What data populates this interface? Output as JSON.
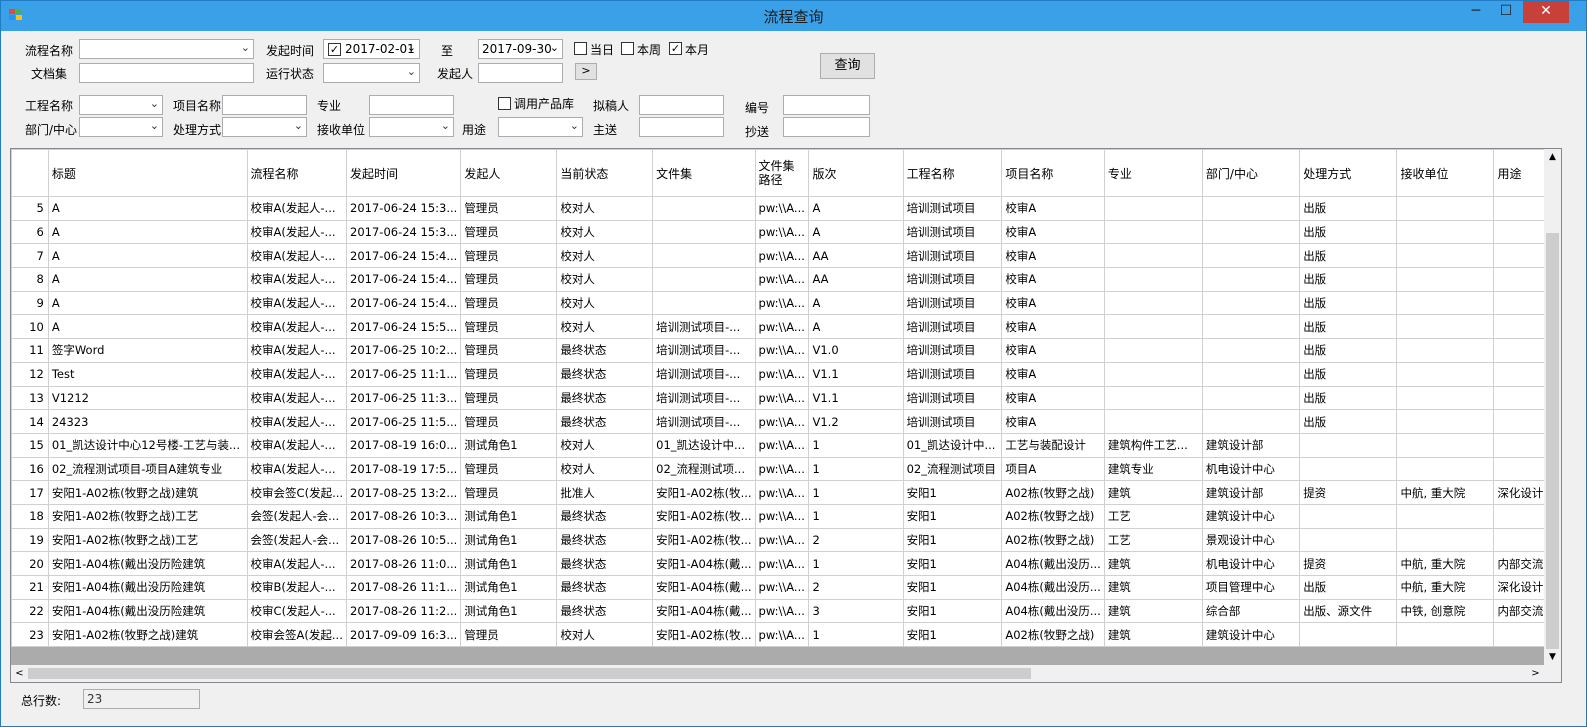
{
  "window": {
    "title": "流程查询",
    "min": "─",
    "max": "☐",
    "close": "✕"
  },
  "filters": {
    "flow_name_label": "流程名称",
    "flow_name_value": "",
    "start_time_label": "发起时间",
    "start_from": "2017-02-01",
    "to_label": "至",
    "start_to": "2017-09-30",
    "today_label": "当日",
    "week_label": "本周",
    "month_label": "本月",
    "docset_label": "文档集",
    "run_status_label": "运行状态",
    "initiator_label": "发起人",
    "more_label": ">",
    "query_label": "查询",
    "project_label": "工程名称",
    "item_label": "项目名称",
    "major_label": "专业",
    "use_product_label": "调用产品库",
    "drafter_label": "拟稿人",
    "number_label": "编号",
    "dept_label": "部门/中心",
    "handle_label": "处理方式",
    "receiver_label": "接收单位",
    "usage_label": "用途",
    "main_send_label": "主送",
    "cc_label": "抄送"
  },
  "grid": {
    "columns": [
      "标题",
      "流程名称",
      "发起时间",
      "发起人",
      "当前状态",
      "文件集",
      "文件集\n路径",
      "版次",
      "工程名称",
      "项目名称",
      "专业",
      "部门/中心",
      "处理方式",
      "接收单位",
      "用途"
    ],
    "rows": [
      [
        "5",
        "A",
        "校审A(发起人-...",
        "2017-06-24 15:3...",
        "管理员",
        "校对人",
        "",
        "pw:\\\\A...",
        "A",
        "培训测试项目",
        "校审A",
        "",
        "",
        "出版",
        "",
        ""
      ],
      [
        "6",
        "A",
        "校审A(发起人-...",
        "2017-06-24 15:3...",
        "管理员",
        "校对人",
        "",
        "pw:\\\\A...",
        "A",
        "培训测试项目",
        "校审A",
        "",
        "",
        "出版",
        "",
        ""
      ],
      [
        "7",
        "A",
        "校审A(发起人-...",
        "2017-06-24 15:4...",
        "管理员",
        "校对人",
        "",
        "pw:\\\\A...",
        "AA",
        "培训测试项目",
        "校审A",
        "",
        "",
        "出版",
        "",
        ""
      ],
      [
        "8",
        "A",
        "校审A(发起人-...",
        "2017-06-24 15:4...",
        "管理员",
        "校对人",
        "",
        "pw:\\\\A...",
        "AA",
        "培训测试项目",
        "校审A",
        "",
        "",
        "出版",
        "",
        ""
      ],
      [
        "9",
        "A",
        "校审A(发起人-...",
        "2017-06-24 15:4...",
        "管理员",
        "校对人",
        "",
        "pw:\\\\A...",
        "A",
        "培训测试项目",
        "校审A",
        "",
        "",
        "出版",
        "",
        ""
      ],
      [
        "10",
        "A",
        "校审A(发起人-...",
        "2017-06-24 15:5...",
        "管理员",
        "校对人",
        "培训测试项目-...",
        "pw:\\\\A...",
        "A",
        "培训测试项目",
        "校审A",
        "",
        "",
        "出版",
        "",
        ""
      ],
      [
        "11",
        "签字Word",
        "校审A(发起人-...",
        "2017-06-25 10:2...",
        "管理员",
        "最终状态",
        "培训测试项目-...",
        "pw:\\\\A...",
        "V1.0",
        "培训测试项目",
        "校审A",
        "",
        "",
        "出版",
        "",
        ""
      ],
      [
        "12",
        "Test",
        "校审A(发起人-...",
        "2017-06-25 11:1...",
        "管理员",
        "最终状态",
        "培训测试项目-...",
        "pw:\\\\A...",
        "V1.1",
        "培训测试项目",
        "校审A",
        "",
        "",
        "出版",
        "",
        ""
      ],
      [
        "13",
        "V1212",
        "校审A(发起人-...",
        "2017-06-25 11:3...",
        "管理员",
        "最终状态",
        "培训测试项目-...",
        "pw:\\\\A...",
        "V1.1",
        "培训测试项目",
        "校审A",
        "",
        "",
        "出版",
        "",
        ""
      ],
      [
        "14",
        "24323",
        "校审A(发起人-...",
        "2017-06-25 11:5...",
        "管理员",
        "最终状态",
        "培训测试项目-...",
        "pw:\\\\A...",
        "V1.2",
        "培训测试项目",
        "校审A",
        "",
        "",
        "出版",
        "",
        ""
      ],
      [
        "15",
        "01_凯达设计中心12号楼-工艺与装...",
        "校审A(发起人-...",
        "2017-08-19 16:0...",
        "测试角色1",
        "校对人",
        "01_凯达设计中...",
        "pw:\\\\A...",
        "1",
        "01_凯达设计中...",
        "工艺与装配设计",
        "建筑构件工艺...",
        "建筑设计部",
        "",
        "",
        ""
      ],
      [
        "16",
        "02_流程测试项目-项目A建筑专业",
        "校审A(发起人-...",
        "2017-08-19 17:5...",
        "管理员",
        "校对人",
        "02_流程测试项...",
        "pw:\\\\A...",
        "1",
        "02_流程测试项目",
        "项目A",
        "建筑专业",
        "机电设计中心",
        "",
        "",
        ""
      ],
      [
        "17",
        "安阳1-A02栋(牧野之战)建筑",
        "校审会签C(发起...",
        "2017-08-25 13:2...",
        "管理员",
        "批准人",
        "安阳1-A02栋(牧...",
        "pw:\\\\A...",
        "1",
        "安阳1",
        "A02栋(牧野之战)",
        "建筑",
        "建筑设计部",
        "提资",
        "中航, 重大院",
        "深化设计"
      ],
      [
        "18",
        "安阳1-A02栋(牧野之战)工艺",
        "会签(发起人-会...",
        "2017-08-26 10:3...",
        "测试角色1",
        "最终状态",
        "安阳1-A02栋(牧...",
        "pw:\\\\A...",
        "1",
        "安阳1",
        "A02栋(牧野之战)",
        "工艺",
        "建筑设计中心",
        "",
        "",
        ""
      ],
      [
        "19",
        "安阳1-A02栋(牧野之战)工艺",
        "会签(发起人-会...",
        "2017-08-26 10:5...",
        "测试角色1",
        "最终状态",
        "安阳1-A02栋(牧...",
        "pw:\\\\A...",
        "2",
        "安阳1",
        "A02栋(牧野之战)",
        "工艺",
        "景观设计中心",
        "",
        "",
        ""
      ],
      [
        "20",
        "安阳1-A04栋(戴出没历险建筑",
        "校审A(发起人-...",
        "2017-08-26 11:0...",
        "测试角色1",
        "最终状态",
        "安阳1-A04栋(戴...",
        "pw:\\\\A...",
        "1",
        "安阳1",
        "A04栋(戴出没历...",
        "建筑",
        "机电设计中心",
        "提资",
        "中航, 重大院",
        "内部交流"
      ],
      [
        "21",
        "安阳1-A04栋(戴出没历险建筑",
        "校审B(发起人-...",
        "2017-08-26 11:1...",
        "测试角色1",
        "最终状态",
        "安阳1-A04栋(戴...",
        "pw:\\\\A...",
        "2",
        "安阳1",
        "A04栋(戴出没历...",
        "建筑",
        "项目管理中心",
        "出版",
        "中航, 重大院",
        "深化设计"
      ],
      [
        "22",
        "安阳1-A04栋(戴出没历险建筑",
        "校审C(发起人-...",
        "2017-08-26 11:2...",
        "测试角色1",
        "最终状态",
        "安阳1-A04栋(戴...",
        "pw:\\\\A...",
        "3",
        "安阳1",
        "A04栋(戴出没历...",
        "建筑",
        "综合部",
        "出版、源文件",
        "中铁, 创意院",
        "内部交流"
      ],
      [
        "23",
        "安阳1-A02栋(牧野之战)建筑",
        "校审会签A(发起...",
        "2017-09-09 16:3...",
        "管理员",
        "校对人",
        "安阳1-A02栋(牧...",
        "pw:\\\\A...",
        "1",
        "安阳1",
        "A02栋(牧野之战)",
        "建筑",
        "建筑设计中心",
        "",
        "",
        ""
      ]
    ]
  },
  "footer": {
    "total_label": "总行数:",
    "total_value": "23"
  },
  "icons": {
    "combo_arrow": "⌄",
    "check": "✓",
    "scroll_up": "▲",
    "scroll_down": "▼",
    "scroll_left": "<",
    "scroll_right": ">"
  }
}
